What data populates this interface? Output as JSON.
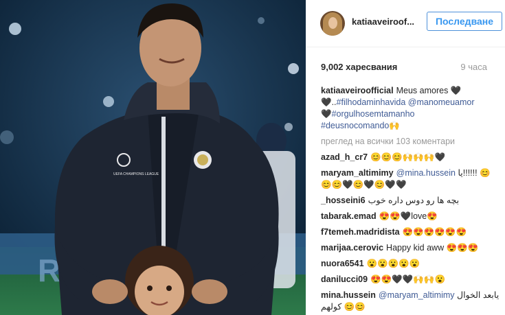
{
  "post": {
    "photo_icon": "photo-of-man-with-child",
    "crest_text": "UEFA CHAMPIONS LEAGUE"
  },
  "header": {
    "username": "katiaaveiroof...",
    "follow_label": "Последване",
    "avatar_icon": "profile-avatar"
  },
  "meta": {
    "likes": "9,002 харесвания",
    "time": "9 часа"
  },
  "caption": {
    "username": "katiaaveiroofficial",
    "text": "Meus amores 🖤",
    "line2_prefix": "🖤..",
    "tag1": "#filhodaminhavida",
    "mention1": "@manomeuamor",
    "line3_prefix": "🖤",
    "tag2": "#orgulhosemtamanho",
    "tag3": "#deusnocomando",
    "tag3_suffix": "🙌"
  },
  "view_all": "преглед на всички 103 коментари",
  "comments": [
    {
      "user": "azad_h_cr7",
      "text": "😊😊😊🙌🙌🙌🖤"
    },
    {
      "user": "maryam_altimimy",
      "mention": "@mina.hussein",
      "text": " يا!!!!!! 😊😊😊🖤😊🖤😊🖤🖤"
    },
    {
      "user": "_hosseini6",
      "text": "بچه ها رو دوس داره خوب"
    },
    {
      "user": "tabarak.emad",
      "text": "😍😍🖤love😍"
    },
    {
      "user": "f7temeh.madridista",
      "text": "😍😍😍😍😍😍"
    },
    {
      "user": "marijaa.cerovic",
      "text": "Happy kid aww 😍😍😍"
    },
    {
      "user": "nuora6541",
      "text": "😮😮😮😮😮"
    },
    {
      "user": "danilucci09",
      "text": "😍😍🖤🖤🙌🙌😮"
    },
    {
      "user": "mina.hussein",
      "mention": "@maryam_altimimy",
      "text": " يابعد الخوال كولهم 😊😊"
    }
  ],
  "colors": {
    "accent": "#3897f0",
    "mention": "#3f5b95",
    "muted": "#999999",
    "jacket": "#1e2532"
  }
}
